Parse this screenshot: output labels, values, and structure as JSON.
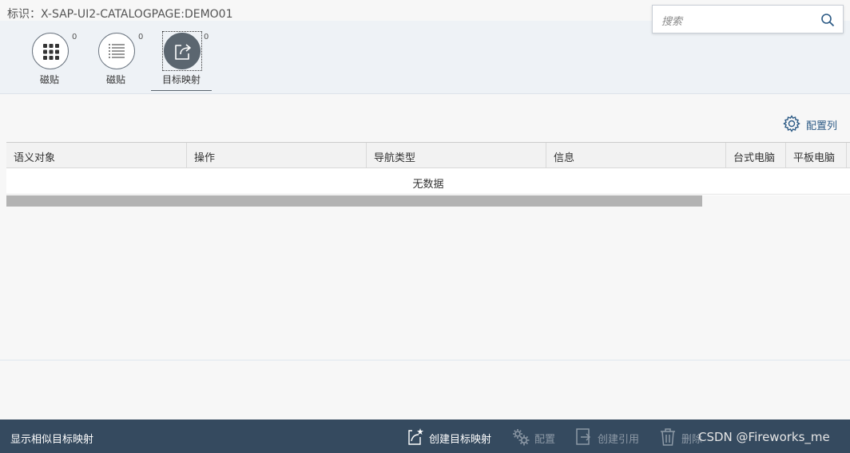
{
  "header": {
    "title": "标识：X-SAP-UI2-CATALOGPAGE:DEMO01"
  },
  "search": {
    "placeholder": "搜索"
  },
  "tabs": [
    {
      "label": "磁贴",
      "count": "0",
      "icon": "grid-icon"
    },
    {
      "label": "磁贴",
      "count": "0",
      "icon": "list-icon"
    },
    {
      "label": "目标映射",
      "count": "0",
      "icon": "share-icon",
      "selected": true
    }
  ],
  "toolbar": {
    "configure_columns_label": "配置列"
  },
  "table": {
    "columns": [
      "语义对象",
      "操作",
      "导航类型",
      "信息",
      "台式电脑",
      "平板电脑"
    ],
    "no_data_text": "无数据"
  },
  "footer": {
    "left_label": "显示相似目标映射",
    "buttons": [
      {
        "label": "创建目标映射",
        "icon": "create-mapping-icon",
        "enabled": true
      },
      {
        "label": "配置",
        "icon": "gears-icon",
        "enabled": false
      },
      {
        "label": "创建引用",
        "icon": "create-reference-icon",
        "enabled": false
      },
      {
        "label": "删除",
        "icon": "trash-icon",
        "enabled": false
      }
    ],
    "watermark": "CSDN @Fireworks_me"
  },
  "colors": {
    "footer_bg": "#354a5f",
    "header_bg": "#eef2f6",
    "link_blue": "#2c5a85",
    "selected_tab": "#5b6670"
  }
}
